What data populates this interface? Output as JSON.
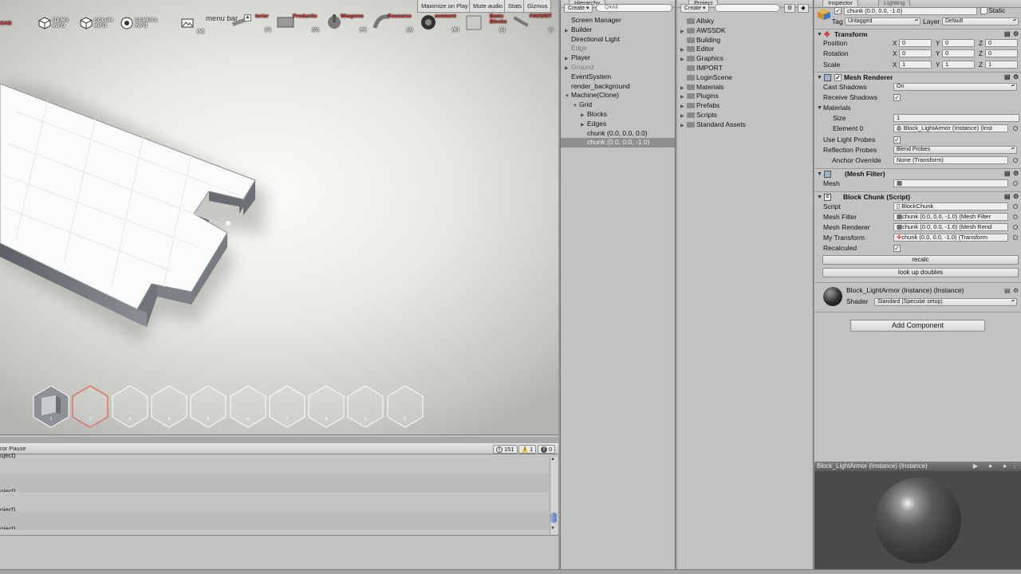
{
  "game_view": {
    "stats_buttons": [
      "Maximize on Play",
      "Mute audio",
      "Stats",
      "Gizmos"
    ],
    "toolbar": {
      "load_label": "OAD",
      "items_label": "ITEMS INFO",
      "color_label": "COLOR INFO",
      "camera_label": "CAMERA INFO",
      "menu_bar": "menu bar",
      "categories": [
        {
          "label": "terior",
          "key": "(F)"
        },
        {
          "label": "Productio",
          "key": "(G)"
        },
        {
          "label": "Weapons",
          "key": "(H)"
        },
        {
          "label": "Resource",
          "key": "(J)"
        },
        {
          "label": "ovement",
          "key": "(K)"
        },
        {
          "label": "Basic Blocks",
          "key": "(L)"
        },
        {
          "label": "FAVORIT",
          "key": "(I)"
        }
      ],
      "key_m": "(M)"
    },
    "hotbar": [
      {
        "num": "1",
        "filled": true,
        "selected": false
      },
      {
        "num": "2",
        "filled": false,
        "selected": true
      },
      {
        "num": "3",
        "filled": false,
        "selected": false
      },
      {
        "num": "4",
        "filled": false,
        "selected": false
      },
      {
        "num": "5",
        "filled": false,
        "selected": false
      },
      {
        "num": "6",
        "filled": false,
        "selected": false
      },
      {
        "num": "7",
        "filled": false,
        "selected": false
      },
      {
        "num": "8",
        "filled": false,
        "selected": false
      },
      {
        "num": "9",
        "filled": false,
        "selected": false
      },
      {
        "num": "0",
        "filled": false,
        "selected": false
      }
    ]
  },
  "console": {
    "error_pause": "ror Pause",
    "counts": {
      "info": "151",
      "warning": "1",
      "error": "0"
    },
    "rows": [
      "oject)",
      "oject)",
      "oject)",
      "oject)",
      "oject)"
    ]
  },
  "hierarchy": {
    "tab": "Hierarchy",
    "create": "Create",
    "search_placeholder": "Q▾All",
    "items": [
      {
        "label": "Screen Manager",
        "arrow": "",
        "grey": false,
        "selected": false
      },
      {
        "label": "Builder",
        "arrow": "▶",
        "grey": false,
        "selected": false
      },
      {
        "label": "Directional Light",
        "arrow": "",
        "grey": false,
        "selected": false
      },
      {
        "label": "Edge",
        "arrow": "",
        "grey": true,
        "selected": false
      },
      {
        "label": "Player",
        "arrow": "▶",
        "grey": false,
        "selected": false
      },
      {
        "label": "Ground",
        "arrow": "▶",
        "grey": true,
        "selected": false
      },
      {
        "label": "EventSystem",
        "arrow": "",
        "grey": false,
        "selected": false
      },
      {
        "label": "render_background",
        "arrow": "",
        "grey": false,
        "selected": false
      },
      {
        "label": "Machine(Clone)",
        "arrow": "▼",
        "grey": false,
        "selected": false
      },
      {
        "label": "Grid",
        "arrow": "▼",
        "grey": false,
        "selected": false
      },
      {
        "label": "Blocks",
        "arrow": "▶",
        "grey": false,
        "selected": false
      },
      {
        "label": "Edges",
        "arrow": "▶",
        "grey": false,
        "selected": false
      },
      {
        "label": "chunk (0.0, 0.0, 0.0)",
        "arrow": "",
        "grey": false,
        "selected": false
      },
      {
        "label": "chunk (0.0, 0.0, -1.0)",
        "arrow": "",
        "grey": false,
        "selected": true
      }
    ]
  },
  "project": {
    "tab": "Project",
    "create": "Create",
    "folders": [
      "Allsky",
      "AWSSDK",
      "Building",
      "Editor",
      "Graphics",
      "IMPORT",
      "LoginScene",
      "Materials",
      "Plugins",
      "Prefabs",
      "Scripts",
      "Standard Assets"
    ]
  },
  "inspector": {
    "tabs": [
      "Inspector",
      "Lighting"
    ],
    "object_name": "chunk (0.0, 0.0, -1.0)",
    "static_label": "Static",
    "tag_label": "Tag",
    "tag_value": "Untagged",
    "layer_label": "Layer",
    "layer_value": "Default",
    "transform": {
      "title": "Transform",
      "rows": [
        {
          "label": "Position",
          "x": "0",
          "y": "0",
          "z": "0"
        },
        {
          "label": "Rotation",
          "x": "0",
          "y": "0",
          "z": "0"
        },
        {
          "label": "Scale",
          "x": "1",
          "y": "1",
          "z": "1"
        }
      ]
    },
    "mesh_renderer": {
      "title": "Mesh Renderer",
      "cast_shadows_label": "Cast Shadows",
      "cast_shadows": "On",
      "receive_shadows_label": "Receive Shadows",
      "materials_label": "Materials",
      "size_label": "Size",
      "size": "1",
      "element0_label": "Element 0",
      "element0": "Block_LightArmor (Instance) (Inst",
      "light_probes_label": "Use Light Probes",
      "reflection_probes_label": "Reflection Probes",
      "reflection_probes": "Blend Probes",
      "anchor_label": "Anchor Override",
      "anchor": "None (Transform)"
    },
    "mesh_filter": {
      "title": "(Mesh Filter)",
      "mesh_label": "Mesh",
      "mesh": ""
    },
    "block_chunk": {
      "title": "Block Chunk (Script)",
      "script_label": "Script",
      "script": "BlockChunk",
      "mesh_filter_label": "Mesh Filter",
      "mesh_filter": "chunk (0.0, 0.0, -1.0) (Mesh Filter",
      "mesh_renderer_label": "Mesh Renderer",
      "mesh_renderer": "chunk (0.0, 0.0, -1.0) (Mesh Rend",
      "my_transform_label": "My Transform",
      "my_transform": "chunk (0.0, 0.0, -1.0) (Transform",
      "recalculed_label": "Recalculed",
      "recalc_button": "recalc",
      "lookup_button": "look up doubles"
    },
    "material": {
      "name": "Block_LightArmor (Instance) (Instance)",
      "shader_label": "Shader",
      "shader": "Standard (Specular setup)"
    },
    "add_component": "Add Component",
    "preview_title": "Block_LightArmor (Instance) (Instance)"
  }
}
